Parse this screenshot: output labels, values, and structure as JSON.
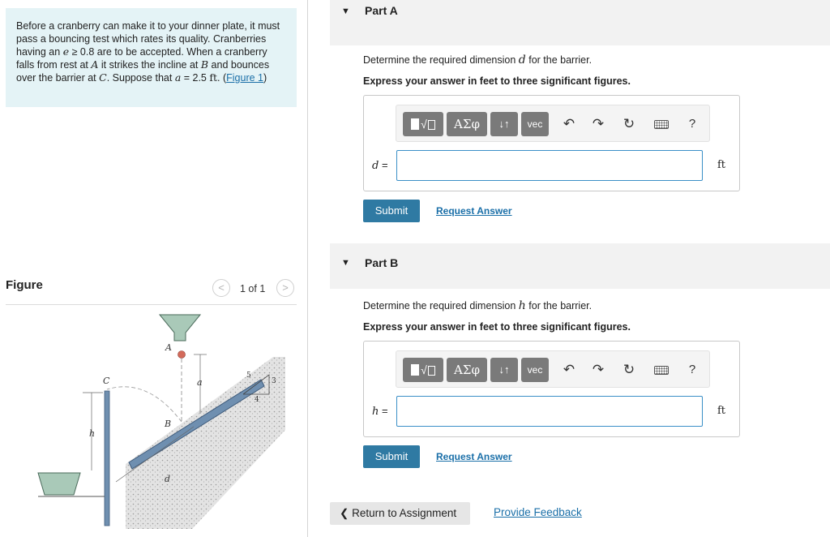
{
  "problem": {
    "text_1": "Before a cranberry can make it to your dinner plate, it must pass a bouncing test which rates its quality. Cranberries having an ",
    "e_symbol": "e",
    "ge_symbol": "≥",
    "text_2": " 0.8 are to be accepted. When a cranberry falls from rest at ",
    "point_a": "A",
    "text_3": " it strikes the incline at ",
    "point_b": "B",
    "text_4": " and bounces over the barrier at ",
    "point_c": "C",
    "text_5": ".  Suppose that ",
    "a_symbol": "a",
    "text_6": " = 2.5 ",
    "ft": "ft",
    "text_7": ". (",
    "figure_link": "Figure 1",
    "text_8": ")"
  },
  "figure": {
    "title": "Figure",
    "pager": "1 of 1",
    "prev_glyph": "<",
    "next_glyph": ">",
    "labels": {
      "A": "A",
      "B": "B",
      "C": "C",
      "a": "a",
      "h": "h",
      "d": "d",
      "n5": "5",
      "n3": "3",
      "n4": "4"
    }
  },
  "part_a": {
    "collapse_glyph": "▼",
    "title": "Part A",
    "prompt_pre": "Determine the required dimension ",
    "prompt_var": "d",
    "prompt_post": " for the barrier.",
    "instruction": "Express your answer in feet to three significant figures.",
    "var_label": "d",
    "equals": " =",
    "unit": "ft",
    "input_value": "",
    "submit": "Submit",
    "request": "Request Answer"
  },
  "part_b": {
    "collapse_glyph": "▼",
    "title": "Part B",
    "prompt_pre": "Determine the required dimension ",
    "prompt_var": "h",
    "prompt_post": " for the barrier.",
    "instruction": "Express your answer in feet to three significant figures.",
    "var_label": "h",
    "equals": " =",
    "unit": "ft",
    "input_value": "",
    "submit": "Submit",
    "request": "Request Answer"
  },
  "toolbar": {
    "greek": "ΑΣφ",
    "arrows": "↓↑",
    "vec": "vec",
    "undo_glyph": "↶",
    "redo_glyph": "↷",
    "reset_glyph": "↻",
    "help": "?"
  },
  "footer": {
    "return_glyph": "❮",
    "return": "Return to Assignment",
    "feedback": "Provide Feedback"
  },
  "colors": {
    "problem_bg": "#e4f3f6",
    "submit_bg": "#2f7aa3",
    "link": "#1a6fa8",
    "toolbar_btn": "#7a7a7a",
    "input_border": "#3a8fc7"
  }
}
